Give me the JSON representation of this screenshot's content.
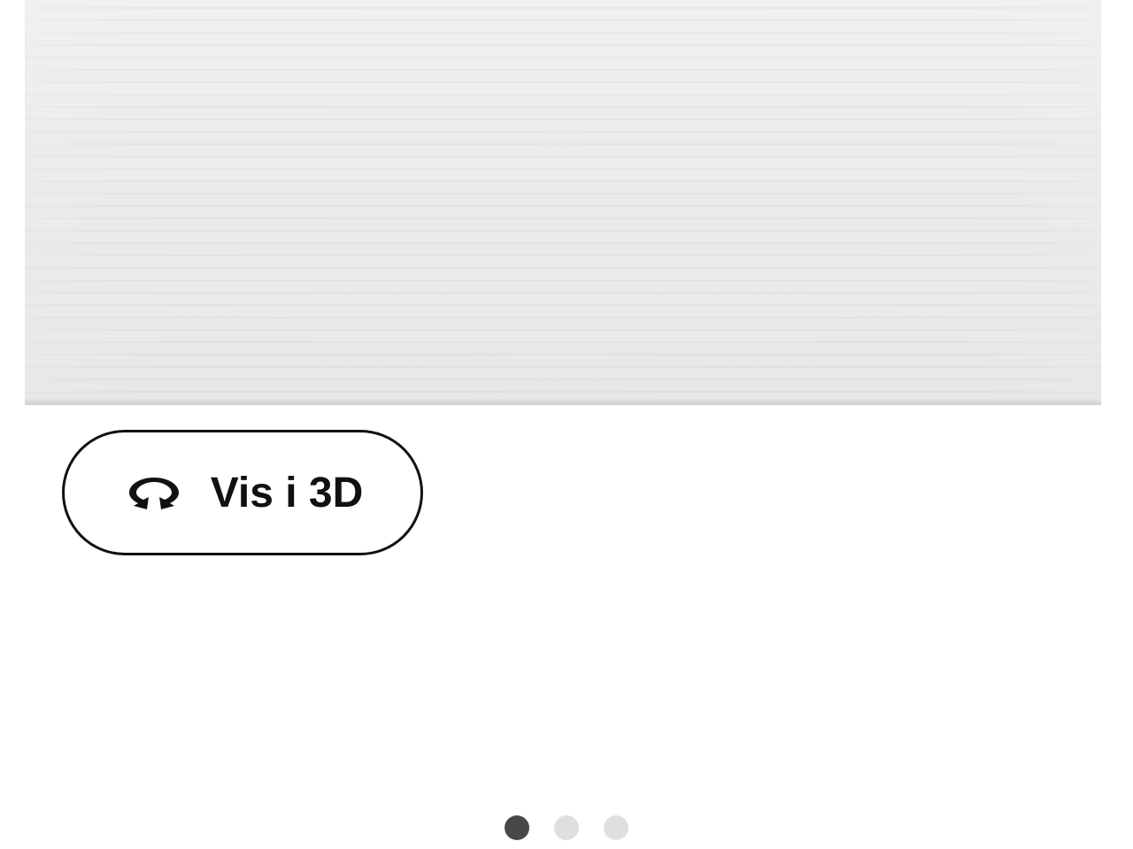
{
  "view_3d": {
    "label": "Vis i 3D"
  },
  "carousel": {
    "total_dots": 3,
    "active_index": 0
  }
}
